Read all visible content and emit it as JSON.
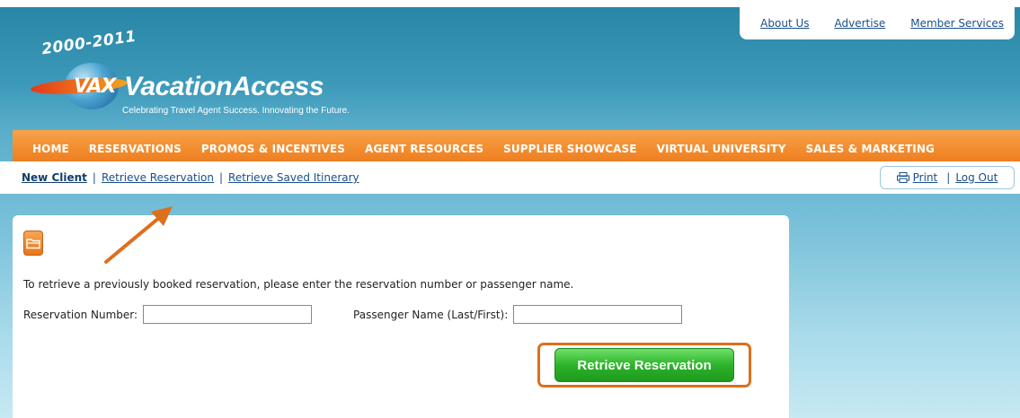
{
  "header": {
    "links": [
      "About Us",
      "Advertise",
      "Member Services"
    ],
    "logo": {
      "years": "2000-2011",
      "mark": "VAX",
      "brand": "VacationAccess",
      "tagline": "Celebrating Travel Agent Success. Innovating the Future."
    }
  },
  "nav": {
    "items": [
      "HOME",
      "RESERVATIONS",
      "PROMOS & INCENTIVES",
      "AGENT RESOURCES",
      "SUPPLIER SHOWCASE",
      "VIRTUAL UNIVERSITY",
      "SALES & MARKETING"
    ]
  },
  "subnav": {
    "links": [
      "New Client",
      "Retrieve Reservation",
      "Retrieve Saved Itinerary"
    ],
    "separator": "|",
    "print_label": "Print",
    "logout_label": "Log Out"
  },
  "main": {
    "instructions": "To retrieve a previously booked reservation, please enter the reservation number or passenger name.",
    "reservation_label": "Reservation Number:",
    "reservation_value": "",
    "passenger_label": "Passenger Name (Last/First):",
    "passenger_value": "",
    "submit_label": "Retrieve Reservation"
  },
  "colors": {
    "nav": "#f28b2c",
    "link": "#1a4f8a",
    "button": "#2cb32a",
    "highlight": "#de6f1d"
  }
}
